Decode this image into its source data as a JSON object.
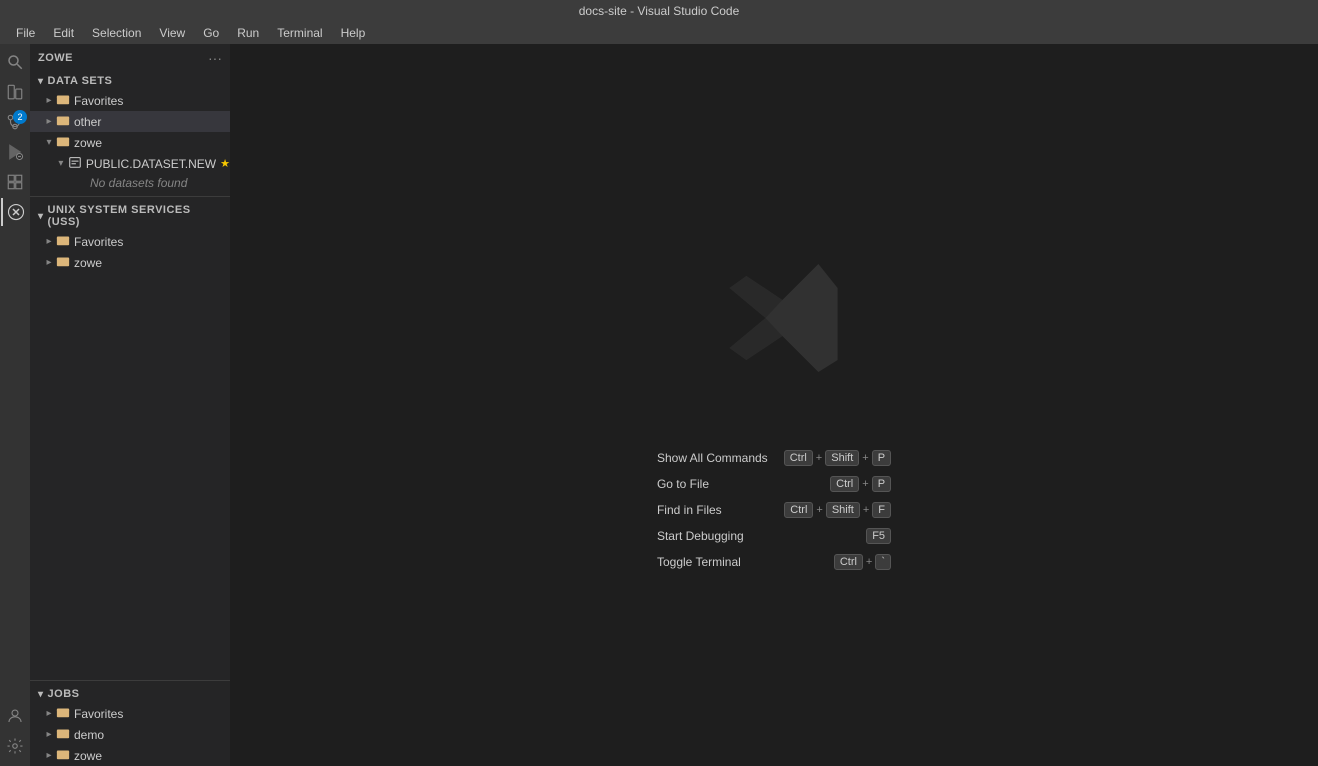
{
  "titleBar": {
    "title": "docs-site - Visual Studio Code"
  },
  "menuBar": {
    "items": [
      "File",
      "Edit",
      "Selection",
      "View",
      "Go",
      "Run",
      "Terminal",
      "Help"
    ]
  },
  "sidebar": {
    "panelTitle": "ZOWE",
    "sections": {
      "dataSets": {
        "label": "DATA SETS",
        "expanded": true,
        "items": [
          {
            "id": "ds-favorites",
            "label": "Favorites",
            "indent": 1,
            "hasChevron": true,
            "chevronDir": "right",
            "icon": "📄",
            "type": "folder"
          },
          {
            "id": "ds-other",
            "label": "other",
            "indent": 1,
            "hasChevron": true,
            "chevronDir": "right",
            "icon": "📁",
            "type": "folder"
          },
          {
            "id": "ds-zowe",
            "label": "zowe",
            "indent": 1,
            "hasChevron": true,
            "chevronDir": "down",
            "icon": "📁",
            "type": "folder",
            "expanded": true
          },
          {
            "id": "ds-zowe-public",
            "label": "PUBLIC.DATASET.NEW",
            "indent": 2,
            "hasChevron": true,
            "chevronDir": "down",
            "icon": "📁",
            "type": "folder",
            "expanded": true,
            "starred": true
          }
        ],
        "noDatasets": "No datasets found"
      },
      "uss": {
        "label": "UNIX SYSTEM SERVICES (USS)",
        "expanded": true,
        "items": [
          {
            "id": "uss-favorites",
            "label": "Favorites",
            "indent": 1,
            "hasChevron": true,
            "chevronDir": "right",
            "icon": "📄",
            "type": "folder"
          },
          {
            "id": "uss-zowe",
            "label": "zowe",
            "indent": 1,
            "hasChevron": true,
            "chevronDir": "right",
            "icon": "📁",
            "type": "folder"
          }
        ]
      },
      "jobs": {
        "label": "JOBS",
        "expanded": true,
        "items": [
          {
            "id": "jobs-favorites",
            "label": "Favorites",
            "indent": 1,
            "hasChevron": true,
            "chevronDir": "right",
            "icon": "📄",
            "type": "folder"
          },
          {
            "id": "jobs-demo",
            "label": "demo",
            "indent": 1,
            "hasChevron": true,
            "chevronDir": "right",
            "icon": "📁",
            "type": "folder"
          },
          {
            "id": "jobs-zowe",
            "label": "zowe",
            "indent": 1,
            "hasChevron": true,
            "chevronDir": "right",
            "icon": "📁",
            "type": "folder"
          }
        ]
      }
    }
  },
  "welcomeScreen": {
    "shortcuts": [
      {
        "label": "Show All Commands",
        "keys": [
          "Ctrl",
          "+",
          "Shift",
          "+",
          "P"
        ]
      },
      {
        "label": "Go to File",
        "keys": [
          "Ctrl",
          "+",
          "P"
        ]
      },
      {
        "label": "Find in Files",
        "keys": [
          "Ctrl",
          "+",
          "Shift",
          "+",
          "F"
        ]
      },
      {
        "label": "Start Debugging",
        "keys": [
          "F5"
        ]
      },
      {
        "label": "Toggle Terminal",
        "keys": [
          "Ctrl",
          "+",
          "`"
        ]
      }
    ]
  },
  "activityBar": {
    "icons": [
      {
        "name": "search-icon",
        "symbol": "🔍",
        "label": "Search"
      },
      {
        "name": "explorer-icon",
        "symbol": "📋",
        "label": "Explorer"
      },
      {
        "name": "source-control-icon",
        "symbol": "⑂",
        "label": "Source Control",
        "badge": "2"
      },
      {
        "name": "debug-icon",
        "symbol": "▷",
        "label": "Run and Debug"
      },
      {
        "name": "extensions-icon",
        "symbol": "⊞",
        "label": "Extensions"
      },
      {
        "name": "zowe-icon",
        "symbol": "Z",
        "label": "Zowe Explorer"
      },
      {
        "name": "accounts-icon",
        "symbol": "👤",
        "label": "Accounts"
      },
      {
        "name": "settings-icon",
        "symbol": "⚙",
        "label": "Settings"
      }
    ]
  }
}
